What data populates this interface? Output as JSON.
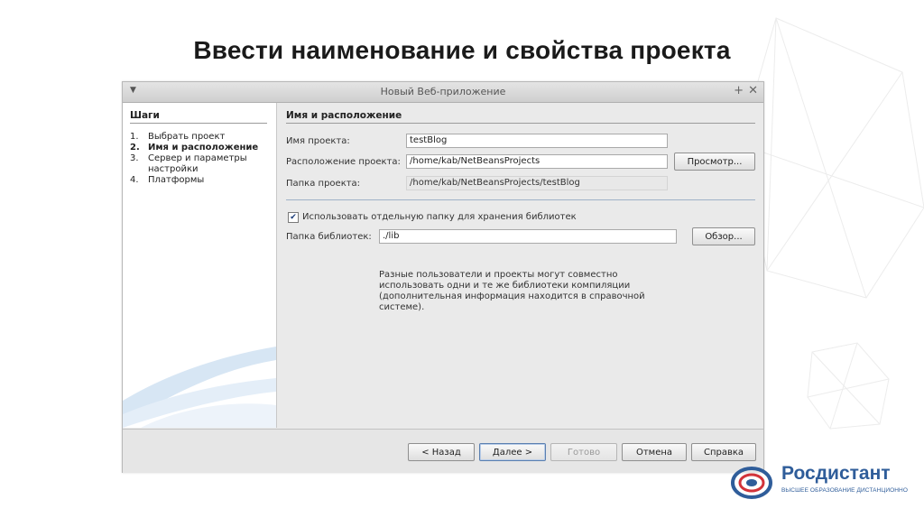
{
  "slide": {
    "title": "Ввести наименование и свойства проекта"
  },
  "dialog": {
    "title": "Новый Веб-приложение",
    "steps": {
      "heading": "Шаги",
      "items": [
        {
          "num": "1.",
          "label": "Выбрать проект"
        },
        {
          "num": "2.",
          "label": "Имя и расположение"
        },
        {
          "num": "3.",
          "label": "Сервер и параметры настройки"
        },
        {
          "num": "4.",
          "label": "Платформы"
        }
      ]
    },
    "section_heading": "Имя и расположение",
    "project_name": {
      "label": "Имя проекта:",
      "value": "testBlog"
    },
    "project_location": {
      "label": "Расположение проекта:",
      "value": "/home/kab/NetBeansProjects",
      "browse_label": "Просмотр..."
    },
    "project_folder": {
      "label": "Папка проекта:",
      "value": "/home/kab/NetBeansProjects/testBlog"
    },
    "shared_libs": {
      "checked": true,
      "label": "Использовать отдельную папку для хранения библиотек"
    },
    "libraries_folder": {
      "label": "Папка библиотек:",
      "value": "./lib",
      "browse_label": "Обзор..."
    },
    "info_text": "Разные пользователи и проекты могут совместно использовать одни и те же библиотеки компиляции (дополнительная информация находится в справочной системе).",
    "buttons": {
      "back": "< Назад",
      "next": "Далее >",
      "finish": "Готово",
      "cancel": "Отмена",
      "help": "Справка"
    }
  },
  "brand": {
    "name": "Росдистант",
    "tagline": "ВЫСШЕЕ ОБРАЗОВАНИЕ ДИСТАНЦИОННО",
    "color": "#2f5d9a"
  }
}
